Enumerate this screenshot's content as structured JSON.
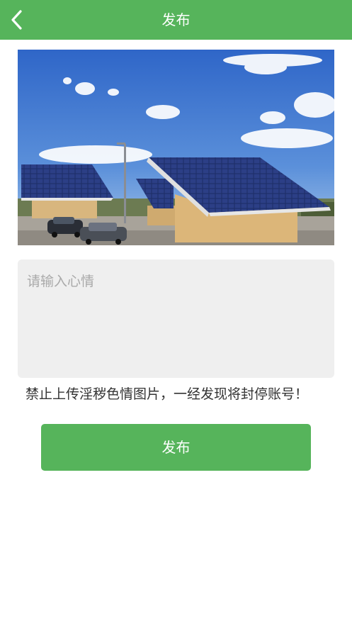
{
  "header": {
    "title": "发布",
    "back_icon": "chevron-left-icon",
    "background_color": "#56b45b"
  },
  "mood": {
    "placeholder": "请输入心情",
    "value": ""
  },
  "warning_text": "禁止上传淫秽色情图片，一经发现将封停账号！",
  "publish_button": {
    "label": "发布",
    "color": "#56b45b"
  }
}
